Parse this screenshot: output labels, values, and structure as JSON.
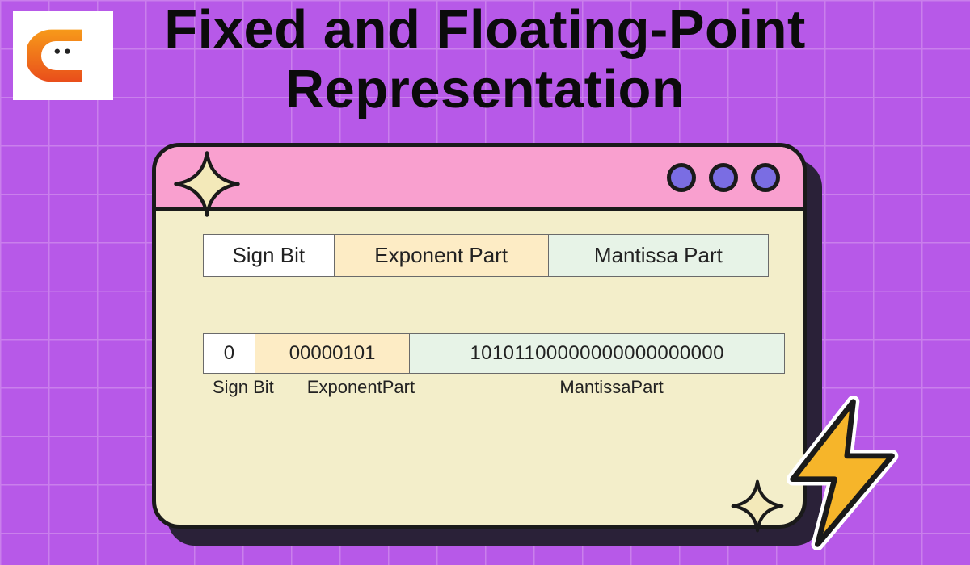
{
  "title": "Fixed and Floating-Point Representation",
  "colors": {
    "background": "#b759e8",
    "grid": "#ca7fec",
    "window_bg": "#f3eeca",
    "titlebar": "#f9a0cf",
    "circle": "#7a6de3",
    "sign_cell": "#ffffff",
    "exponent_cell": "#fdecc5",
    "mantissa_cell": "#e7f3e7",
    "border": "#1a1a1a",
    "sparkle": "#f3e9b9",
    "bolt_fill": "#f6b52a",
    "bolt_stroke": "#1a1a1a",
    "bolt_outline": "#ffffff"
  },
  "legend": {
    "sign_label": "Sign Bit",
    "exponent_label": "Exponent Part",
    "mantissa_label": "Mantissa Part"
  },
  "example": {
    "sign_value": "0",
    "exponent_value": "00000101",
    "mantissa_value": "10101100000000000000000",
    "sign_label": "Sign Bit",
    "exponent_label": "Exponent Part",
    "mantissa_label": "Mantissa Part"
  },
  "icons": {
    "logo": "coding-ninjas-logo",
    "sparkle_tl": "sparkle-icon",
    "sparkle_br": "sparkle-icon",
    "bolt": "lightning-bolt-icon",
    "window_circle": "window-control-circle"
  }
}
